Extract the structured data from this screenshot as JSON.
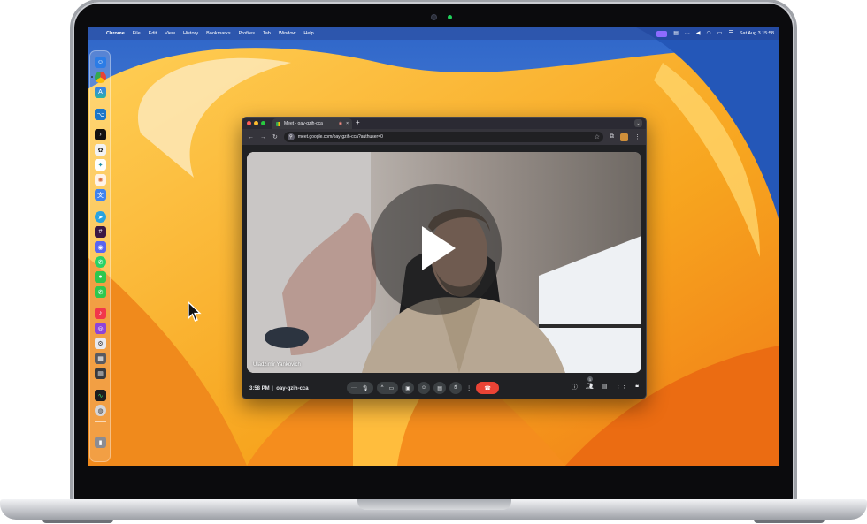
{
  "menubar": {
    "apple": "",
    "app": "Chrome",
    "items": [
      "File",
      "Edit",
      "View",
      "History",
      "Bookmarks",
      "Profiles",
      "Tab",
      "Window",
      "Help"
    ],
    "clock": "Sat Aug 3  15:58"
  },
  "dock": {
    "icons": [
      "finder-icon",
      "chrome-icon",
      "arc-icon",
      "vscode-icon",
      "terminal-icon",
      "chatgpt-icon",
      "perplexity-icon",
      "claude-icon",
      "translate-icon",
      "telegram-icon",
      "slack-icon",
      "discord-icon",
      "whatsapp-icon",
      "messages-icon",
      "phone-icon",
      "music-icon",
      "podcasts-icon",
      "system-settings-icon",
      "photo-icon",
      "calculator-icon",
      "activity-monitor-icon",
      "disk-icon",
      "trash-icon"
    ]
  },
  "browser": {
    "tab_title": "Meet - oay-gzih-cca",
    "url": "meet.google.com/oay-gzih-cca?authuser=0",
    "new_tab": "+",
    "close": "×"
  },
  "meet": {
    "participant": "Uladzimir Yankovich",
    "time": "3:58 PM",
    "separator": "|",
    "meeting_code": "oay-gzih-cca",
    "participants_count": "1"
  },
  "colors": {
    "hangup": "#ea4335",
    "meet_bg": "#202124",
    "wallpaper_orange": "#f6a21e"
  }
}
